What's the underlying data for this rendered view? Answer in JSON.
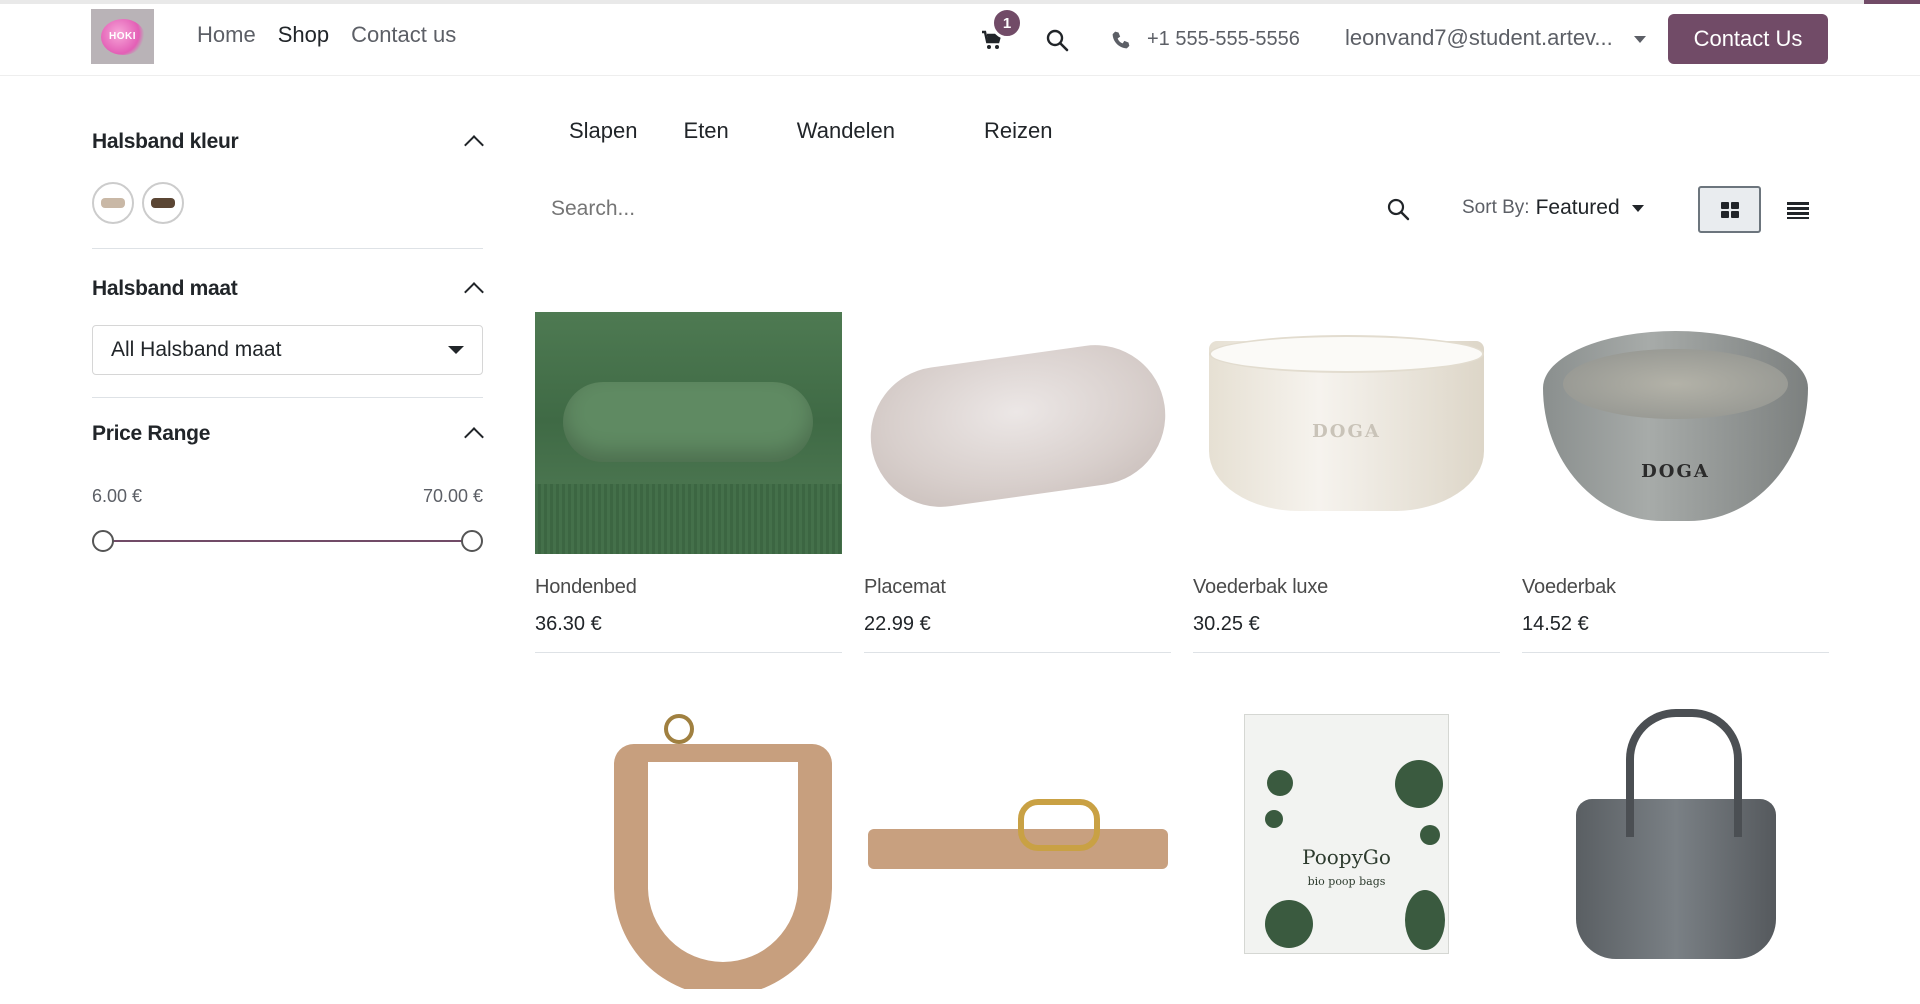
{
  "header": {
    "logo_text": "HOKI",
    "nav": [
      {
        "label": "Home",
        "active": false
      },
      {
        "label": "Shop",
        "active": true
      },
      {
        "label": "Contact us",
        "active": false
      }
    ],
    "cart_count": "1",
    "phone": "+1 555-555-5556",
    "user": "leonvand7@student.artev...",
    "cta": "Contact Us",
    "accent_color": "#714b67"
  },
  "sidebar": {
    "collar_color": {
      "title": "Halsband kleur",
      "swatches": [
        {
          "name": "light",
          "color": "#c9b8a6"
        },
        {
          "name": "dark",
          "color": "#5b4634"
        }
      ]
    },
    "collar_size": {
      "title": "Halsband maat",
      "selected": "All Halsband maat"
    },
    "price": {
      "title": "Price Range",
      "min": "6.00 €",
      "max": "70.00 €"
    }
  },
  "categories": [
    "Slapen",
    "Eten",
    "Wandelen",
    "Reizen"
  ],
  "search": {
    "placeholder": "Search..."
  },
  "sort": {
    "label": "Sort By:",
    "value": "Featured"
  },
  "products": [
    {
      "name": "Hondenbed",
      "price": "36.30 €"
    },
    {
      "name": "Placemat",
      "price": "22.99 €"
    },
    {
      "name": "Voederbak luxe",
      "price": "30.25 €"
    },
    {
      "name": "Voederbak",
      "price": "14.52 €"
    }
  ],
  "product_images": {
    "bowl_brand": "DOGA",
    "poop_brand": "PoopyGo",
    "poop_sub": "bio poop bags"
  }
}
